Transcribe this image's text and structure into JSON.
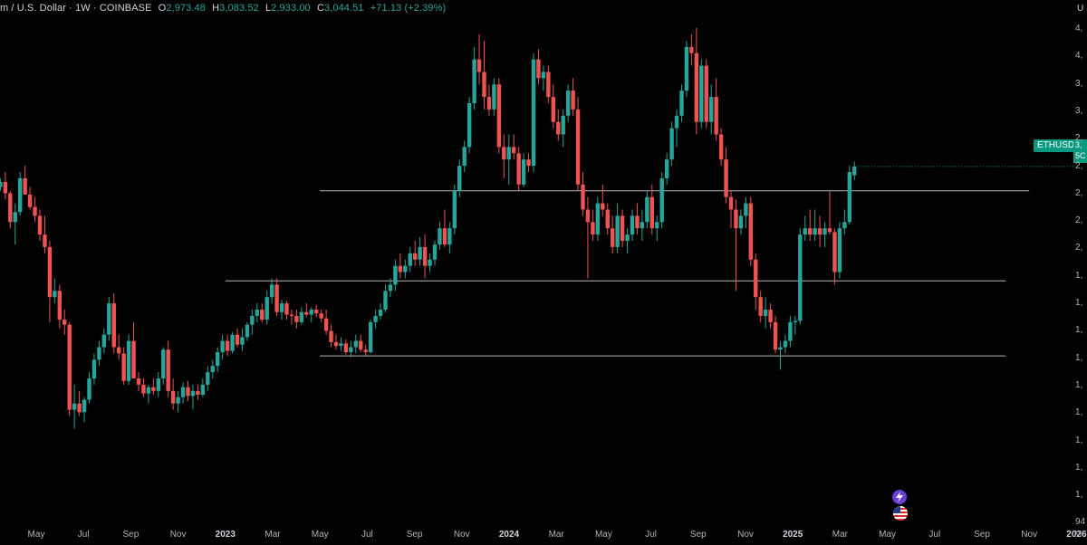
{
  "legend": {
    "symbol": "m / U.S. Dollar · 1W · COINBASE",
    "o_label": "O",
    "o": "2,973.48",
    "h_label": "H",
    "h": "3,083.52",
    "l_label": "L",
    "l": "2,933.00",
    "c_label": "C",
    "c": "3,044.51",
    "change": "+71.13 (+2.39%)"
  },
  "price_tag": {
    "label": "ETHUSD",
    "value_fragment": "3,",
    "sub_fragment": "5C"
  },
  "corner_label": "U",
  "colors": {
    "up": "#26a69a",
    "down": "#ef5350",
    "background": "#000000",
    "level_line": "#b8b8b8",
    "tag": "#089981"
  },
  "chart_data": {
    "type": "candlestick",
    "y_axis_partial_labels": [
      "4,",
      "4,",
      "3,",
      "3,",
      "2,",
      "2,",
      "2,",
      "2,",
      "2,",
      "1,",
      "1,",
      "1,",
      "1,",
      "1,",
      "1,",
      "1,",
      "1,",
      "1,",
      "94"
    ],
    "x_ticks": [
      "May",
      "Jul",
      "Sep",
      "Nov",
      "2023",
      "Mar",
      "May",
      "Jul",
      "Sep",
      "Nov",
      "2024",
      "Mar",
      "May",
      "Jul",
      "Sep",
      "Nov",
      "2025",
      "Mar",
      "May",
      "Jul",
      "Sep",
      "Nov",
      "2026",
      "M"
    ],
    "year_ticks": [
      "2023",
      "2024",
      "2025",
      "2026"
    ],
    "horizontal_levels": [
      {
        "price": 2850,
        "from": "2023-05",
        "to": "2025-11"
      },
      {
        "price": 2130,
        "from": "2023-01",
        "to": "2025-10"
      },
      {
        "price": 1530,
        "from": "2023-05",
        "to": "2025-10"
      }
    ],
    "last_close": 3044.51,
    "candles": [
      [
        2880,
        2950,
        2850,
        2920
      ],
      [
        2920,
        3000,
        2780,
        2830
      ],
      [
        2830,
        2850,
        2550,
        2600
      ],
      [
        2600,
        2750,
        2420,
        2680
      ],
      [
        2680,
        3000,
        2650,
        2950
      ],
      [
        2950,
        3050,
        2900,
        2820
      ],
      [
        2820,
        2880,
        2700,
        2720
      ],
      [
        2720,
        2800,
        2600,
        2650
      ],
      [
        2650,
        2700,
        2450,
        2500
      ],
      [
        2500,
        2650,
        2350,
        2400
      ],
      [
        2400,
        2450,
        1800,
        2000
      ],
      [
        2000,
        2150,
        1950,
        2050
      ],
      [
        2050,
        2100,
        1750,
        1820
      ],
      [
        1820,
        1900,
        1700,
        1780
      ],
      [
        1780,
        1800,
        1050,
        1100
      ],
      [
        1100,
        1300,
        950,
        1150
      ],
      [
        1150,
        1250,
        1050,
        1080
      ],
      [
        1080,
        1200,
        1000,
        1180
      ],
      [
        1180,
        1400,
        1150,
        1350
      ],
      [
        1350,
        1550,
        1300,
        1500
      ],
      [
        1500,
        1650,
        1450,
        1600
      ],
      [
        1600,
        1750,
        1550,
        1700
      ],
      [
        1700,
        2000,
        1650,
        1950
      ],
      [
        1950,
        2030,
        1550,
        1600
      ],
      [
        1600,
        1700,
        1500,
        1550
      ],
      [
        1550,
        1600,
        1300,
        1330
      ],
      [
        1330,
        1700,
        1300,
        1650
      ],
      [
        1650,
        1800,
        1600,
        1350
      ],
      [
        1350,
        1400,
        1250,
        1300
      ],
      [
        1300,
        1350,
        1200,
        1230
      ],
      [
        1230,
        1300,
        1150,
        1280
      ],
      [
        1280,
        1350,
        1220,
        1250
      ],
      [
        1250,
        1400,
        1200,
        1350
      ],
      [
        1350,
        1600,
        1300,
        1580
      ],
      [
        1580,
        1650,
        1200,
        1250
      ],
      [
        1250,
        1350,
        1100,
        1150
      ],
      [
        1150,
        1250,
        1080,
        1200
      ],
      [
        1200,
        1320,
        1150,
        1280
      ],
      [
        1280,
        1330,
        1170,
        1210
      ],
      [
        1210,
        1300,
        1100,
        1250
      ],
      [
        1250,
        1300,
        1180,
        1220
      ],
      [
        1220,
        1350,
        1200,
        1300
      ],
      [
        1300,
        1450,
        1250,
        1400
      ],
      [
        1400,
        1500,
        1350,
        1450
      ],
      [
        1450,
        1600,
        1400,
        1560
      ],
      [
        1560,
        1700,
        1500,
        1650
      ],
      [
        1650,
        1700,
        1530,
        1570
      ],
      [
        1570,
        1720,
        1550,
        1700
      ],
      [
        1700,
        1750,
        1600,
        1620
      ],
      [
        1620,
        1750,
        1570,
        1680
      ],
      [
        1680,
        1800,
        1650,
        1780
      ],
      [
        1780,
        1900,
        1700,
        1850
      ],
      [
        1850,
        1950,
        1800,
        1900
      ],
      [
        1900,
        1950,
        1800,
        1820
      ],
      [
        1820,
        2050,
        1780,
        2000
      ],
      [
        2000,
        2150,
        1950,
        2100
      ],
      [
        2100,
        2150,
        1850,
        1880
      ],
      [
        1880,
        1980,
        1820,
        1950
      ],
      [
        1950,
        1970,
        1820,
        1860
      ],
      [
        1860,
        1900,
        1780,
        1850
      ],
      [
        1850,
        1900,
        1750,
        1800
      ],
      [
        1800,
        1920,
        1780,
        1880
      ],
      [
        1880,
        1950,
        1840,
        1860
      ],
      [
        1860,
        1920,
        1800,
        1900
      ],
      [
        1900,
        1940,
        1840,
        1870
      ],
      [
        1870,
        1900,
        1800,
        1830
      ],
      [
        1830,
        1900,
        1700,
        1730
      ],
      [
        1730,
        1780,
        1600,
        1640
      ],
      [
        1640,
        1700,
        1580,
        1610
      ],
      [
        1610,
        1680,
        1570,
        1630
      ],
      [
        1630,
        1660,
        1540,
        1560
      ],
      [
        1560,
        1650,
        1520,
        1600
      ],
      [
        1600,
        1700,
        1550,
        1650
      ],
      [
        1650,
        1700,
        1560,
        1580
      ],
      [
        1580,
        1620,
        1530,
        1560
      ],
      [
        1560,
        1820,
        1550,
        1800
      ],
      [
        1800,
        1900,
        1750,
        1850
      ],
      [
        1850,
        1950,
        1820,
        1900
      ],
      [
        1900,
        2100,
        1880,
        2050
      ],
      [
        2050,
        2150,
        2000,
        2100
      ],
      [
        2100,
        2300,
        2050,
        2250
      ],
      [
        2250,
        2350,
        2150,
        2200
      ],
      [
        2200,
        2300,
        2150,
        2250
      ],
      [
        2250,
        2400,
        2200,
        2350
      ],
      [
        2350,
        2450,
        2250,
        2300
      ],
      [
        2300,
        2480,
        2250,
        2400
      ],
      [
        2400,
        2500,
        2150,
        2250
      ],
      [
        2250,
        2350,
        2200,
        2300
      ],
      [
        2300,
        2450,
        2250,
        2420
      ],
      [
        2420,
        2600,
        2380,
        2550
      ],
      [
        2550,
        2700,
        2400,
        2420
      ],
      [
        2420,
        2600,
        2350,
        2550
      ],
      [
        2550,
        2900,
        2500,
        2850
      ],
      [
        2850,
        3100,
        2800,
        3050
      ],
      [
        3050,
        3250,
        3000,
        3200
      ],
      [
        3200,
        3600,
        3150,
        3550
      ],
      [
        3550,
        4000,
        3500,
        3900
      ],
      [
        3900,
        4100,
        3700,
        3800
      ],
      [
        3800,
        4050,
        3500,
        3600
      ],
      [
        3600,
        3700,
        3450,
        3500
      ],
      [
        3500,
        3750,
        3450,
        3700
      ],
      [
        3700,
        3750,
        3150,
        3200
      ],
      [
        3200,
        3300,
        2950,
        3100
      ],
      [
        3100,
        3300,
        2900,
        3200
      ],
      [
        3200,
        3300,
        3100,
        3150
      ],
      [
        3150,
        3200,
        2850,
        2900
      ],
      [
        2900,
        3150,
        2880,
        3100
      ],
      [
        3100,
        3150,
        3000,
        3050
      ],
      [
        3050,
        3950,
        3000,
        3900
      ],
      [
        3900,
        3980,
        3700,
        3750
      ],
      [
        3750,
        3850,
        3650,
        3800
      ],
      [
        3800,
        3850,
        3550,
        3600
      ],
      [
        3600,
        3700,
        3350,
        3400
      ],
      [
        3400,
        3500,
        3250,
        3300
      ],
      [
        3300,
        3500,
        3200,
        3450
      ],
      [
        3450,
        3700,
        3400,
        3650
      ],
      [
        3650,
        3750,
        3450,
        3500
      ],
      [
        3500,
        3600,
        2850,
        2900
      ],
      [
        2900,
        3000,
        2650,
        2700
      ],
      [
        2700,
        2800,
        2150,
        2600
      ],
      [
        2600,
        2700,
        2450,
        2500
      ],
      [
        2500,
        2800,
        2450,
        2750
      ],
      [
        2750,
        2900,
        2650,
        2700
      ],
      [
        2700,
        2750,
        2500,
        2550
      ],
      [
        2550,
        2650,
        2350,
        2400
      ],
      [
        2400,
        2750,
        2350,
        2650
      ],
      [
        2650,
        2700,
        2400,
        2450
      ],
      [
        2450,
        2550,
        2350,
        2500
      ],
      [
        2500,
        2700,
        2450,
        2650
      ],
      [
        2650,
        2750,
        2500,
        2550
      ],
      [
        2550,
        2700,
        2450,
        2600
      ],
      [
        2600,
        2850,
        2550,
        2800
      ],
      [
        2800,
        2900,
        2500,
        2550
      ],
      [
        2550,
        2650,
        2450,
        2600
      ],
      [
        2600,
        3000,
        2550,
        2950
      ],
      [
        2950,
        3150,
        2900,
        3100
      ],
      [
        3100,
        3400,
        3050,
        3350
      ],
      [
        3350,
        3500,
        3200,
        3450
      ],
      [
        3450,
        3700,
        3400,
        3650
      ],
      [
        3650,
        4050,
        3600,
        4000
      ],
      [
        4000,
        4100,
        3850,
        3950
      ],
      [
        3950,
        4150,
        3300,
        3400
      ],
      [
        3400,
        3900,
        3350,
        3850
      ],
      [
        3850,
        3900,
        3350,
        3400
      ],
      [
        3400,
        3700,
        3300,
        3600
      ],
      [
        3600,
        3750,
        3250,
        3300
      ],
      [
        3300,
        3350,
        3050,
        3100
      ],
      [
        3100,
        3200,
        2750,
        2800
      ],
      [
        2800,
        2850,
        2550,
        2700
      ],
      [
        2700,
        2780,
        2050,
        2550
      ],
      [
        2550,
        2700,
        2500,
        2650
      ],
      [
        2650,
        2800,
        2550,
        2750
      ],
      [
        2750,
        2800,
        2250,
        2300
      ],
      [
        2300,
        2350,
        1900,
        2000
      ],
      [
        2000,
        2050,
        1800,
        1850
      ],
      [
        1850,
        2000,
        1750,
        1900
      ],
      [
        1900,
        1950,
        1750,
        1800
      ],
      [
        1800,
        1850,
        1550,
        1580
      ],
      [
        1580,
        1650,
        1420,
        1600
      ],
      [
        1600,
        1700,
        1550,
        1650
      ],
      [
        1650,
        1850,
        1600,
        1800
      ],
      [
        1800,
        1850,
        1700,
        1810
      ],
      [
        1810,
        2550,
        1780,
        2500
      ],
      [
        2500,
        2650,
        2450,
        2550
      ],
      [
        2550,
        2700,
        2450,
        2500
      ],
      [
        2500,
        2700,
        2450,
        2550
      ],
      [
        2550,
        2650,
        2400,
        2500
      ],
      [
        2500,
        2600,
        2400,
        2550
      ],
      [
        2550,
        2850,
        2500,
        2520
      ],
      [
        2520,
        2550,
        2100,
        2200
      ],
      [
        2200,
        2600,
        2150,
        2550
      ],
      [
        2550,
        2700,
        2500,
        2600
      ],
      [
        2600,
        3050,
        2580,
        3000
      ],
      [
        2973.48,
        3083.52,
        2933,
        3044.51
      ]
    ]
  }
}
